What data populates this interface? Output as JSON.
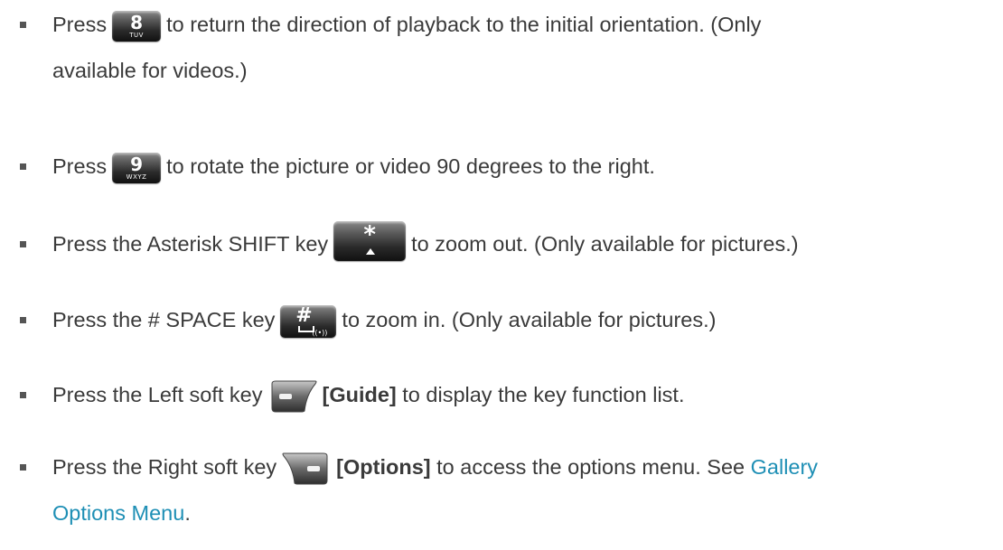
{
  "items": [
    {
      "before": "Press",
      "key": {
        "icon": "key-8-icon",
        "main": "8",
        "sub": "TUV"
      },
      "after_line1": "to return the direction of playback to the initial orientation. (Only",
      "line2": "available for videos.)"
    },
    {
      "before": "Press",
      "key": {
        "icon": "key-9-icon",
        "main": "9",
        "sub": "WXYZ"
      },
      "after": "to rotate the picture or video 90 degrees to the right."
    },
    {
      "before": "Press the Asterisk SHIFT key",
      "key": {
        "icon": "asterisk-shift-key-icon",
        "main": "*"
      },
      "after": "to zoom out. (Only available for pictures.)"
    },
    {
      "before": "Press the # SPACE key",
      "key": {
        "icon": "hash-space-key-icon",
        "main": "#"
      },
      "after": "to zoom in. (Only available for pictures.)"
    },
    {
      "before": "Press the Left soft key",
      "key": {
        "icon": "left-soft-key-icon"
      },
      "bold": "[Guide]",
      "after": "to display the key function list."
    },
    {
      "before": "Press the Right soft key",
      "key": {
        "icon": "right-soft-key-icon"
      },
      "bold": "[Options]",
      "after": "to access the options menu. See",
      "link_line1": "Gallery",
      "link_line2": "Options Menu",
      "end": "."
    }
  ],
  "colors": {
    "text": "#3a3a3a",
    "link": "#1e8fb5",
    "bullet": "#555555"
  }
}
